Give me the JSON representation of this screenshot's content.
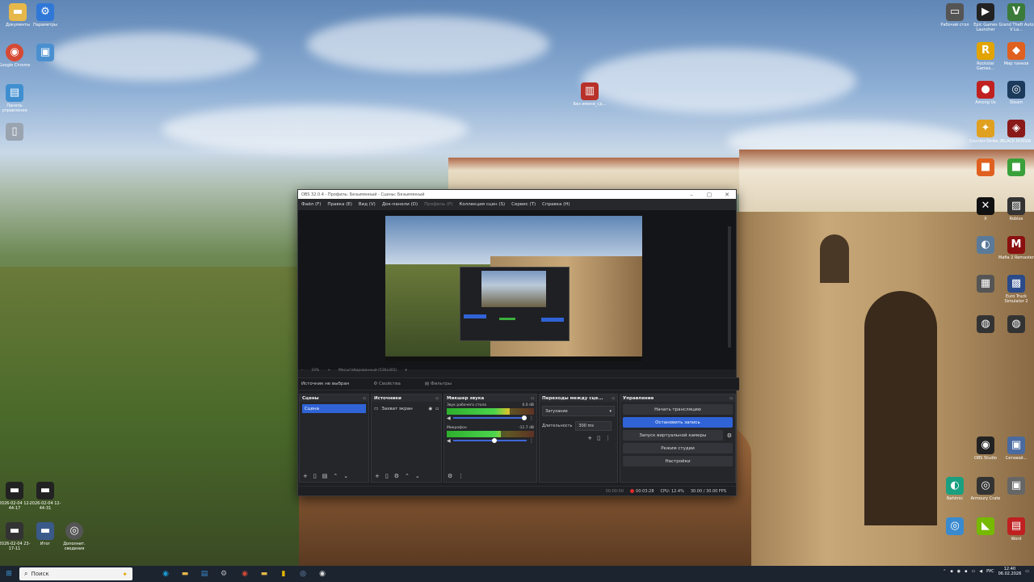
{
  "desktop": {
    "icons_left": [
      {
        "label": "Документы",
        "glyph": "📁",
        "color": "#e6b84a"
      },
      {
        "label": "Параметры",
        "glyph": "⚙",
        "color": "#2f78d8"
      },
      {
        "label": "Google Chrome",
        "glyph": "◉",
        "color": "#d64a35"
      },
      {
        "label": "",
        "glyph": "▣",
        "color": "#4a90d0"
      },
      {
        "label": "Панель управления",
        "glyph": "▤",
        "color": "#3f8fd0"
      },
      {
        "label": "",
        "glyph": "🗑",
        "color": "#9aa4b0"
      }
    ],
    "icon_center": {
      "label": "Без имени_сд...",
      "glyph": "▥",
      "color": "#b8322a"
    },
    "icons_right": [
      {
        "label": "Рабочий стол",
        "glyph": "▭",
        "color": "#555"
      },
      {
        "label": "Epic Games Launcher",
        "glyph": "▶",
        "color": "#222"
      },
      {
        "label": "Grand Theft Auto V La...",
        "glyph": "V",
        "color": "#3a7a3a"
      },
      {
        "label": "Rockstar Games...",
        "glyph": "R",
        "color": "#e2a400"
      },
      {
        "label": "Мир танков",
        "glyph": "◆",
        "color": "#e06020"
      },
      {
        "label": "Among Us",
        "glyph": "●",
        "color": "#c02020"
      },
      {
        "label": "Steam",
        "glyph": "◎",
        "color": "#1b3a5c"
      },
      {
        "label": "Counter-Strike 2",
        "glyph": "✦",
        "color": "#e0a020"
      },
      {
        "label": "BLACK RUSSIA",
        "glyph": "◈",
        "color": "#8a1a1a"
      },
      {
        "label": "",
        "glyph": "■",
        "color": "#e06020"
      },
      {
        "label": "",
        "glyph": "■",
        "color": "#3aa03a"
      },
      {
        "label": "X",
        "glyph": "✕",
        "color": "#111"
      },
      {
        "label": "Roblox",
        "glyph": "▨",
        "color": "#333"
      },
      {
        "label": "",
        "glyph": "◐",
        "color": "#5a7a9a"
      },
      {
        "label": "Mafia 2 Remaster",
        "glyph": "M",
        "color": "#8a1010"
      },
      {
        "label": "",
        "glyph": "▦",
        "color": "#555"
      },
      {
        "label": "Euro Truck Simulator 2",
        "glyph": "▩",
        "color": "#2a4a8a"
      },
      {
        "label": "",
        "glyph": "◍",
        "color": "#333"
      },
      {
        "label": "",
        "glyph": "◍",
        "color": "#333"
      },
      {
        "label": "OBS Studio",
        "glyph": "◉",
        "color": "#222"
      },
      {
        "label": "",
        "glyph": "▶",
        "color": "#2a9a6a"
      },
      {
        "label": "Nahimic",
        "glyph": "◐",
        "color": "#1aa080"
      },
      {
        "label": "Armoury Crate",
        "glyph": "◎",
        "color": "#333"
      },
      {
        "label": "",
        "glyph": "▣",
        "color": "#666"
      },
      {
        "label": "Сетевой...",
        "glyph": "▣",
        "color": "#4a6aa0"
      },
      {
        "label": "",
        "glyph": "◎",
        "color": "#3a8ad0"
      },
      {
        "label": "",
        "glyph": "◆",
        "color": "#20b0c0"
      },
      {
        "label": "Word",
        "glyph": "W",
        "color": "#2b579a"
      },
      {
        "label": "",
        "glyph": "◣",
        "color": "#76b900"
      },
      {
        "label": "",
        "glyph": "▤",
        "color": "#c02020"
      }
    ],
    "icons_bottom_left": [
      {
        "label": "2026-02-04 12-44-17",
        "glyph": "▬",
        "color": "#222"
      },
      {
        "label": "2026-02-04 12-44-31",
        "glyph": "▬",
        "color": "#222"
      },
      {
        "label": "2026-02-04 23-17-11",
        "glyph": "▬",
        "color": "#333"
      },
      {
        "label": "Итог",
        "glyph": "▬",
        "color": "#3a5a8a"
      },
      {
        "label": "Дополнит. сведения",
        "glyph": "◎",
        "color": "#555"
      }
    ]
  },
  "obs": {
    "title": "OBS 32.0.4 - Профиль: Безымянный - Сцены: Безымянный",
    "menu": [
      "Файл (F)",
      "Правка (E)",
      "Вид (V)",
      "Док-панели (D)",
      "Профиль (P)",
      "Коллекция сцен (S)",
      "Сервис (T)",
      "Справка (H)"
    ],
    "zoom": "33%",
    "scale_label": "Масштабированный (536x301)",
    "source_bar": {
      "none_selected": "Источник не выбран",
      "properties": "Свойства",
      "filters": "Фильтры"
    },
    "scenes": {
      "title": "Сцены",
      "items": [
        "Сцена"
      ]
    },
    "sources": {
      "title": "Источники",
      "items": [
        "Захват экран"
      ]
    },
    "mixer": {
      "title": "Микшер звука",
      "channels": [
        {
          "name": "Звук рабочего стола",
          "db": "0.0 dB",
          "level": 0.72,
          "volume": 1.0
        },
        {
          "name": "Микрофон",
          "db": "-11.7 dB",
          "level": 0.62,
          "volume": 0.6
        }
      ]
    },
    "transitions": {
      "title": "Переходы между сце...",
      "type": "Затухание",
      "duration_label": "Длительность",
      "duration_value": "300 ms"
    },
    "controls": {
      "title": "Управление",
      "start_stream": "Начать трансляцию",
      "stop_record": "Остановить запись",
      "virtual_cam": "Запуск виртуальной камеры",
      "studio_mode": "Режим студии",
      "settings": "Настройки"
    },
    "status": {
      "stream_time": "00:00:00",
      "rec_time": "00:03:28",
      "cpu": "CPU: 12.4%",
      "fps": "30.00 / 30.00 FPS"
    }
  },
  "taskbar": {
    "search_placeholder": "Поиск",
    "apps": [
      {
        "name": "Edge",
        "glyph": "◉",
        "color": "#1aa0d8"
      },
      {
        "name": "Проводник",
        "glyph": "▬",
        "color": "#e6b84a"
      },
      {
        "name": "Store",
        "glyph": "▤",
        "color": "#3a8ad0"
      },
      {
        "name": "Settings",
        "glyph": "⚙",
        "color": "#bbb"
      },
      {
        "name": "Chrome",
        "glyph": "◉",
        "color": "#d64a35"
      },
      {
        "name": "Explorer",
        "glyph": "▬",
        "color": "#e6b84a"
      },
      {
        "name": "Bars",
        "glyph": "▮",
        "color": "#e6b800"
      },
      {
        "name": "Steam",
        "glyph": "◎",
        "color": "#7aa0c8"
      },
      {
        "name": "OBS",
        "glyph": "◉",
        "color": "#ddd"
      }
    ],
    "lang": "РУС",
    "time": "12:40",
    "date": "06.02.2026"
  }
}
